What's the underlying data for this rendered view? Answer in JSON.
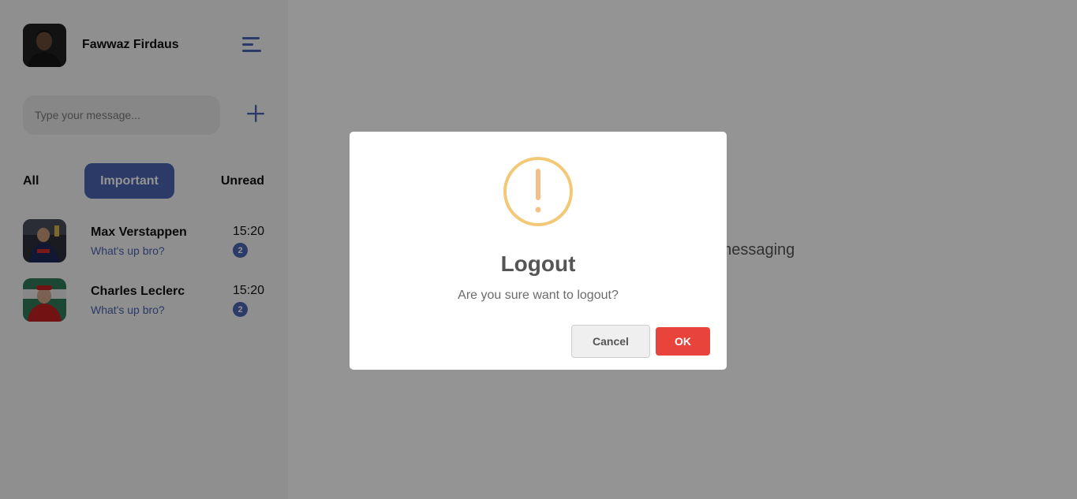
{
  "profile": {
    "name": "Fawwaz Firdaus"
  },
  "search": {
    "placeholder": "Type your message..."
  },
  "tabs": [
    {
      "label": "All"
    },
    {
      "label": "Important"
    },
    {
      "label": "Unread"
    }
  ],
  "chats": [
    {
      "name": "Max Verstappen",
      "message": "What's up bro?",
      "time": "15:20",
      "unread": "2"
    },
    {
      "name": "Charles Leclerc",
      "message": "What's up bro?",
      "time": "15:20",
      "unread": "2"
    }
  ],
  "main": {
    "empty_text": "Select a chat to start messaging"
  },
  "modal": {
    "title": "Logout",
    "text": "Are you sure want to logout?",
    "cancel_label": "Cancel",
    "ok_label": "OK"
  },
  "colors": {
    "accent": "#4a64b0",
    "danger": "#e8443c",
    "warning": "#f3c978"
  }
}
